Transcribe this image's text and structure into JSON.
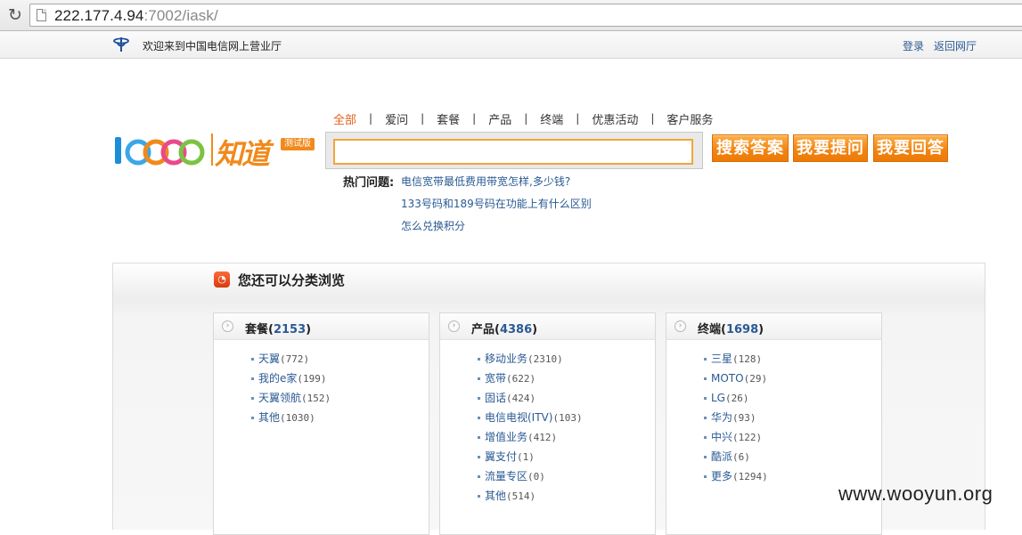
{
  "browser": {
    "url_host": "222.177.4.94",
    "url_rest": ":7002/iask/"
  },
  "topbar": {
    "welcome": "欢迎来到中国电信网上营业厅",
    "login": "登录",
    "back": "返回网厅"
  },
  "logo": {
    "number": "10000",
    "name": "知道",
    "badge": "测试版"
  },
  "categories": [
    "全部",
    "爱问",
    "套餐",
    "产品",
    "终端",
    "优惠活动",
    "客户服务"
  ],
  "search": {
    "value": "",
    "buttons": [
      "搜索答案",
      "我要提问",
      "我要回答"
    ]
  },
  "hot": {
    "label": "热门问题:",
    "questions": [
      "电信宽带最低费用带宽怎样,多少钱?",
      "133号码和189号码在功能上有什么区别",
      "怎么兑换积分"
    ]
  },
  "browse": {
    "title": "您还可以分类浏览",
    "cards": [
      {
        "name": "套餐",
        "count": "2153",
        "items": [
          {
            "label": "天翼",
            "count": "(772)"
          },
          {
            "label": "我的e家",
            "count": "(199)"
          },
          {
            "label": "天翼领航",
            "count": "(152)"
          },
          {
            "label": "其他",
            "count": "(1030)"
          }
        ]
      },
      {
        "name": "产品",
        "count": "4386",
        "items": [
          {
            "label": "移动业务",
            "count": "(2310)"
          },
          {
            "label": "宽带",
            "count": "(622)"
          },
          {
            "label": "固话",
            "count": "(424)"
          },
          {
            "label": "电信电视(ITV)",
            "count": "(103)"
          },
          {
            "label": "增值业务",
            "count": "(412)"
          },
          {
            "label": "翼支付",
            "count": "(1)"
          },
          {
            "label": "流量专区",
            "count": "(0)"
          },
          {
            "label": "其他",
            "count": "(514)"
          }
        ]
      },
      {
        "name": "终端",
        "count": "1698",
        "items": [
          {
            "label": "三星",
            "count": "(128)"
          },
          {
            "label": "MOTO",
            "count": "(29)"
          },
          {
            "label": "LG",
            "count": "(26)"
          },
          {
            "label": "华为",
            "count": "(93)"
          },
          {
            "label": "中兴",
            "count": "(122)"
          },
          {
            "label": "酷派",
            "count": "(6)"
          },
          {
            "label": "更多",
            "count": "(1294)"
          }
        ]
      }
    ]
  },
  "watermark": "www.wooyun.org",
  "colors": {
    "accent": "#f08a1c",
    "link": "#2a5a93",
    "active_tab": "#e5611a"
  }
}
